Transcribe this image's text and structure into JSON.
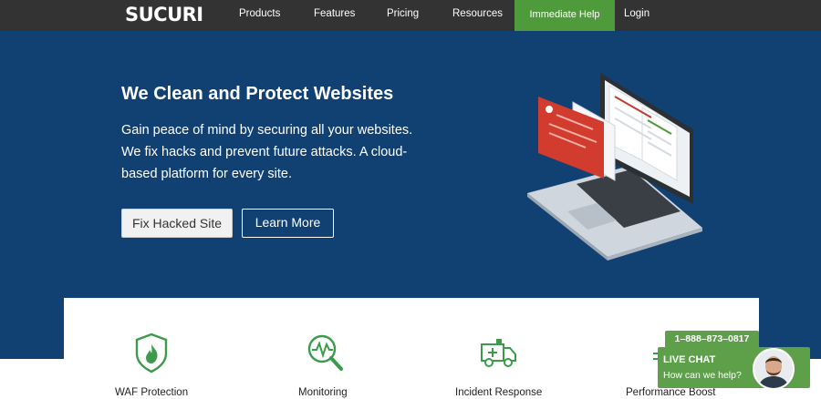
{
  "header": {
    "logo": "SUCURI",
    "nav": {
      "products": "Products",
      "features": "Features",
      "pricing": "Pricing",
      "resources": "Resources",
      "immediate_help": "Immediate Help",
      "login": "Login"
    }
  },
  "hero": {
    "title": "We Clean and Protect Websites",
    "description_lines": [
      "Gain peace of mind by securing all your websites.",
      "We fix hacks and prevent future attacks. A cloud-",
      "based platform for every site."
    ],
    "primary_button": "Fix Hacked Site",
    "secondary_button": "Learn More"
  },
  "features": [
    {
      "label": "WAF Protection",
      "icon": "shield-flame-icon"
    },
    {
      "label": "Monitoring",
      "icon": "magnifier-pulse-icon"
    },
    {
      "label": "Incident Response",
      "icon": "ambulance-icon"
    },
    {
      "label": "Performance Boost",
      "icon": "speed-icon"
    }
  ],
  "live_chat": {
    "phone": "1–888–873–0817",
    "title": "LIVE CHAT",
    "subtitle": "How can we help?"
  },
  "colors": {
    "nav_bg": "#333333",
    "hero_bg": "#104172",
    "brand_green": "#4f9a3a",
    "chat_green": "#5ea04a"
  }
}
